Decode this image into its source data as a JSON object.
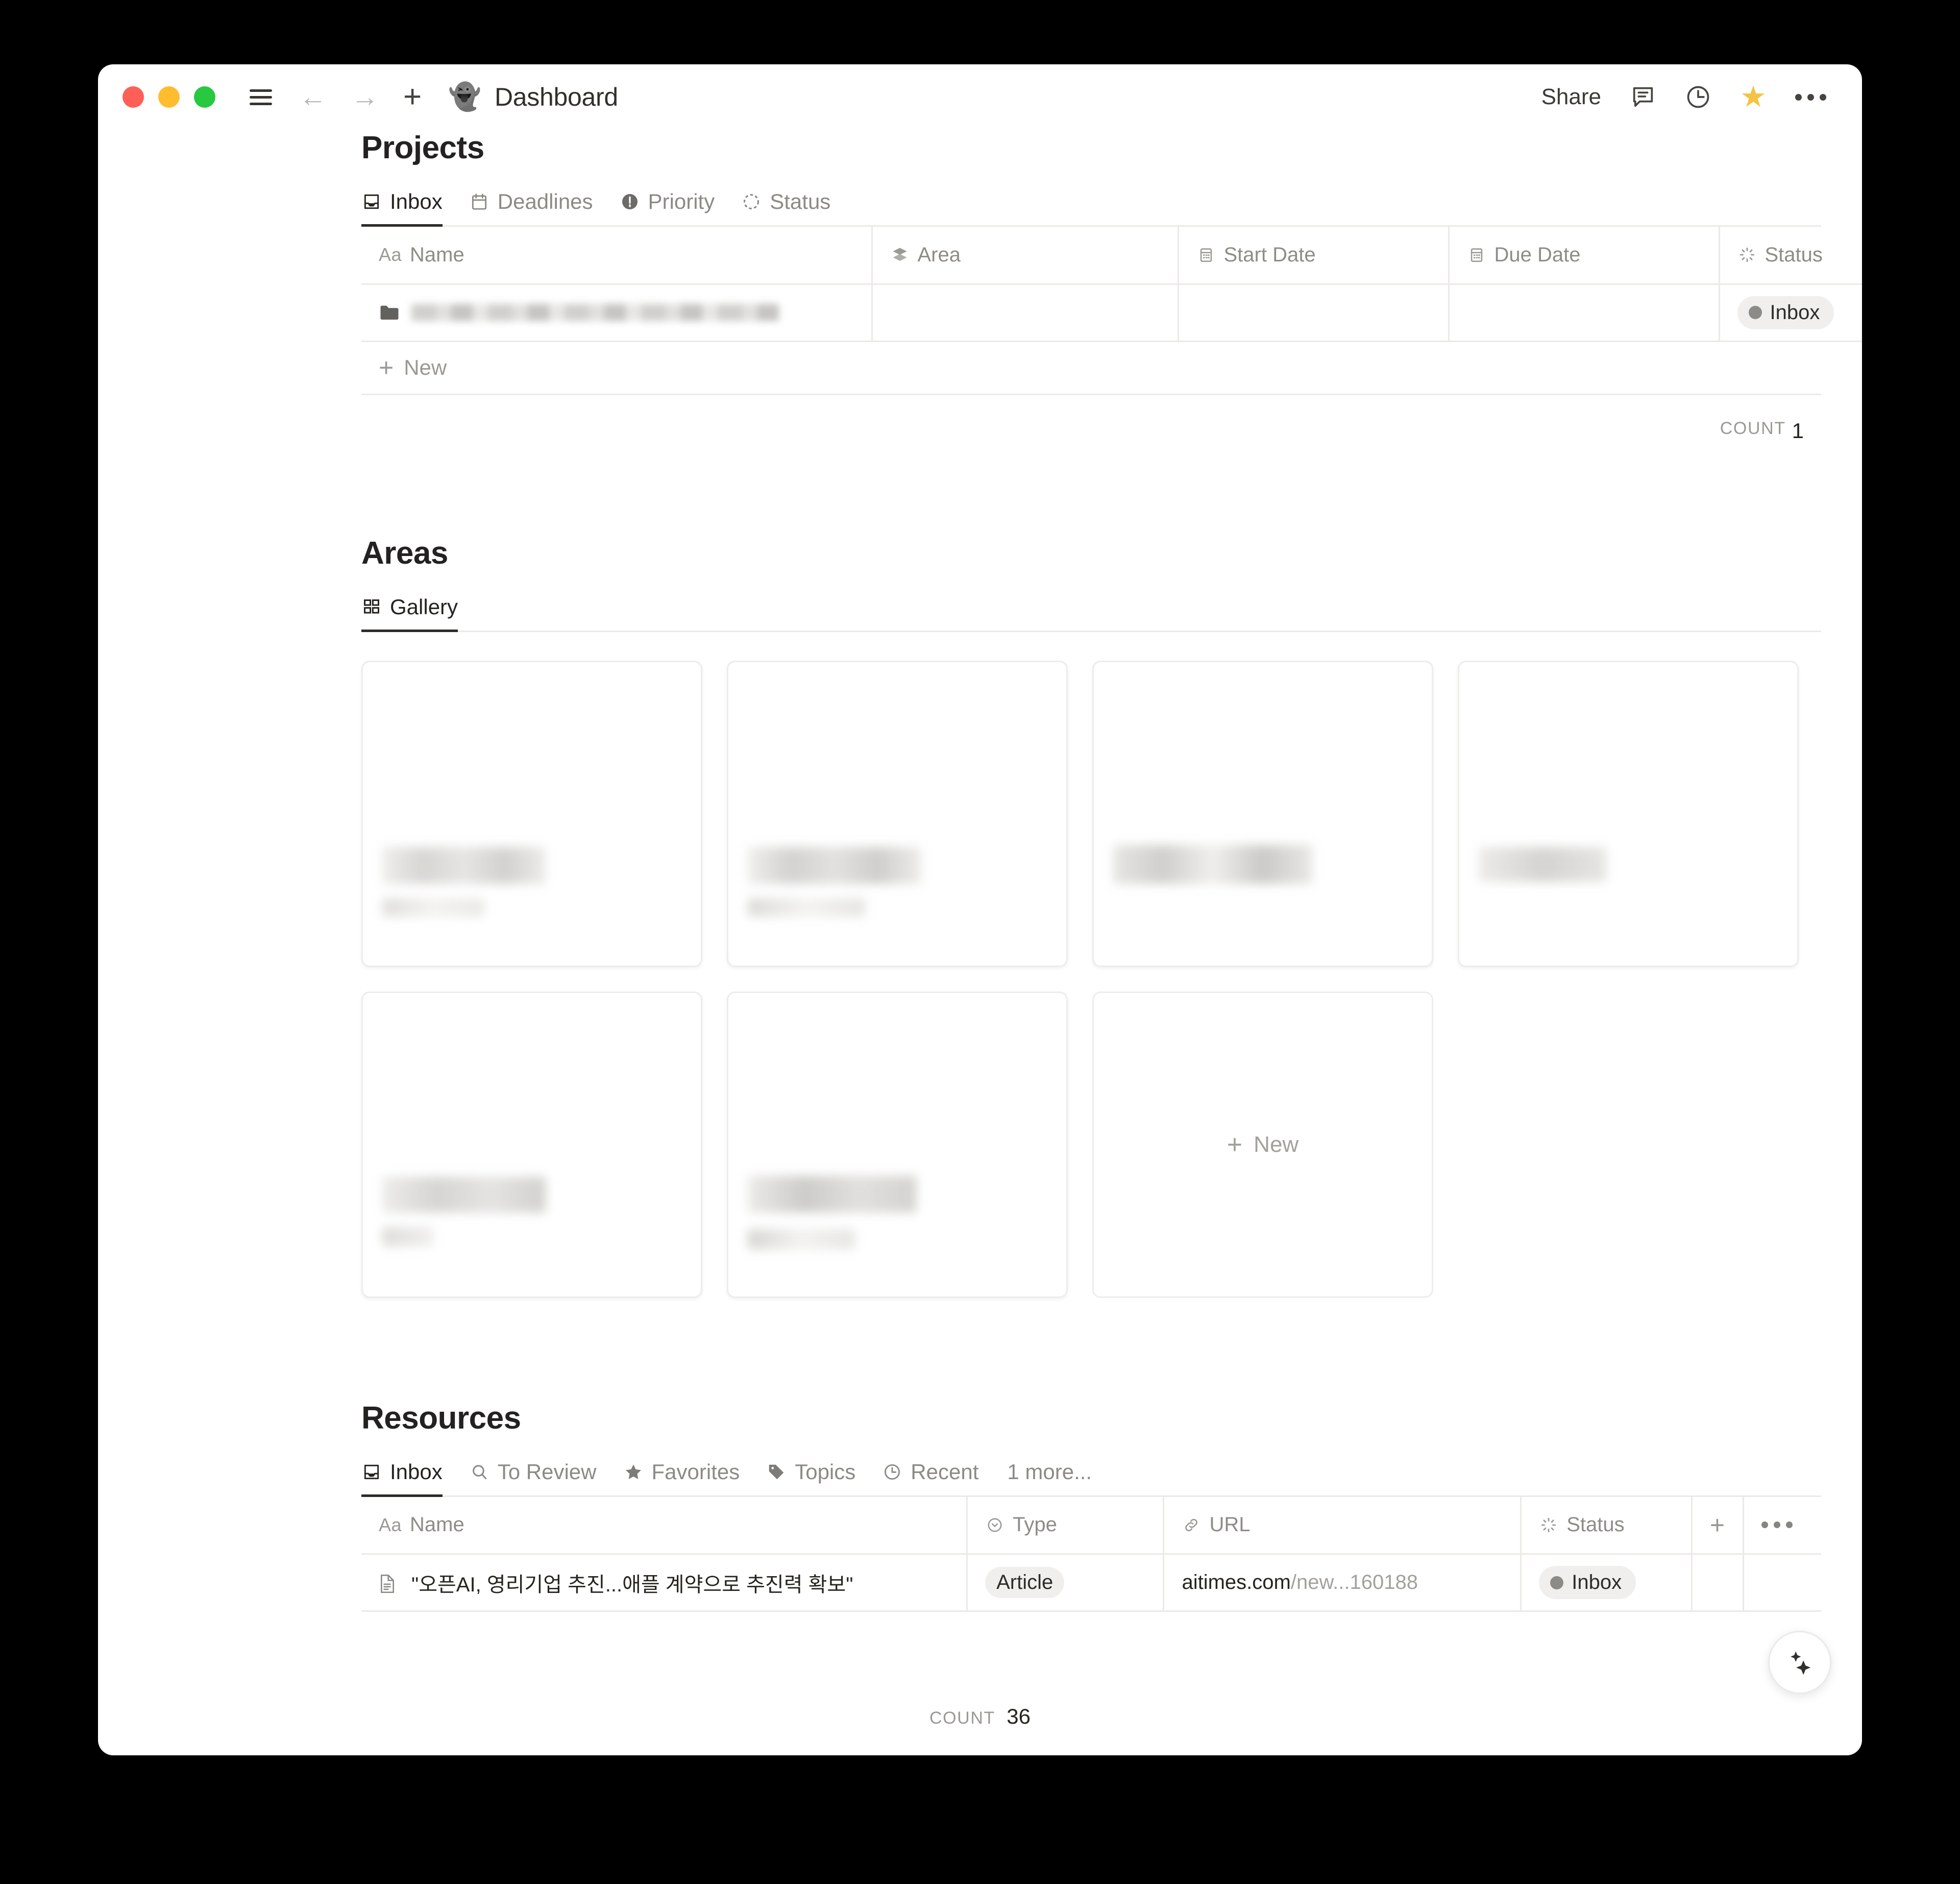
{
  "window": {
    "title": "Dashboard",
    "app_icon": "ghost-icon",
    "traffic_lights": [
      "close",
      "minimize",
      "maximize"
    ],
    "toolbar_left_icons": [
      "menu-icon",
      "back-arrow-icon",
      "forward-arrow-icon",
      "plus-icon"
    ],
    "toolbar_right": {
      "share_label": "Share",
      "icons": [
        "comment-icon",
        "history-clock-icon",
        "star-icon",
        "more-options-icon"
      ],
      "star_color": "#f5c344"
    }
  },
  "projects": {
    "heading": "Projects",
    "tabs": [
      {
        "label": "Inbox",
        "icon": "inbox-tray-icon",
        "active": true
      },
      {
        "label": "Deadlines",
        "icon": "calendar-icon",
        "active": false
      },
      {
        "label": "Priority",
        "icon": "exclamation-circle-icon",
        "active": false
      },
      {
        "label": "Status",
        "icon": "dashed-circle-icon",
        "active": false
      }
    ],
    "columns": [
      {
        "label": "Name",
        "icon": "aa-text-icon"
      },
      {
        "label": "Area",
        "icon": "layers-icon"
      },
      {
        "label": "Start Date",
        "icon": "calendar-icon"
      },
      {
        "label": "Due Date",
        "icon": "calendar-icon"
      },
      {
        "label": "Status",
        "icon": "status-spinner-icon"
      }
    ],
    "rows": [
      {
        "name": "",
        "name_redacted": true,
        "icon": "folder-icon",
        "area": "",
        "start_date": "",
        "due_date": "",
        "status": "Inbox"
      }
    ],
    "new_row_label": "New",
    "count_label": "COUNT",
    "count_value": "1"
  },
  "areas": {
    "heading": "Areas",
    "tabs": [
      {
        "label": "Gallery",
        "icon": "gallery-grid-icon",
        "active": true
      }
    ],
    "cards": [
      {
        "title_redacted": true,
        "has_subtitle": true
      },
      {
        "title_redacted": true,
        "has_subtitle": true
      },
      {
        "title_redacted": true,
        "has_subtitle": false
      },
      {
        "title_redacted": true,
        "has_subtitle": false
      },
      {
        "title_redacted": true,
        "has_subtitle": true
      },
      {
        "title_redacted": true,
        "has_subtitle": true
      }
    ],
    "new_card_label": "New"
  },
  "resources": {
    "heading": "Resources",
    "tabs": [
      {
        "label": "Inbox",
        "icon": "inbox-tray-icon",
        "active": true
      },
      {
        "label": "To Review",
        "icon": "search-icon",
        "active": false
      },
      {
        "label": "Favorites",
        "icon": "star-icon",
        "active": false
      },
      {
        "label": "Topics",
        "icon": "tag-icon",
        "active": false
      },
      {
        "label": "Recent",
        "icon": "clock-icon",
        "active": false
      }
    ],
    "more_tabs_label": "1 more...",
    "columns": [
      {
        "label": "Name",
        "icon": "aa-text-icon"
      },
      {
        "label": "Type",
        "icon": "select-circle-icon"
      },
      {
        "label": "URL",
        "icon": "link-icon"
      },
      {
        "label": "Status",
        "icon": "status-spinner-icon"
      }
    ],
    "add_column_icon": "plus-icon",
    "column_options_icon": "more-options-icon",
    "rows": [
      {
        "icon": "document-icon",
        "name": "\"오픈AI, 영리기업 추진...애플 계약으로 추진력 확보\"",
        "type": "Article",
        "url_domain": "aitimes.com",
        "url_path": "/new...160188",
        "status": "Inbox"
      }
    ],
    "count_label": "COUNT",
    "count_value": "36"
  },
  "ai_button": {
    "icon": "sparkles-icon",
    "glyph": "✦"
  }
}
